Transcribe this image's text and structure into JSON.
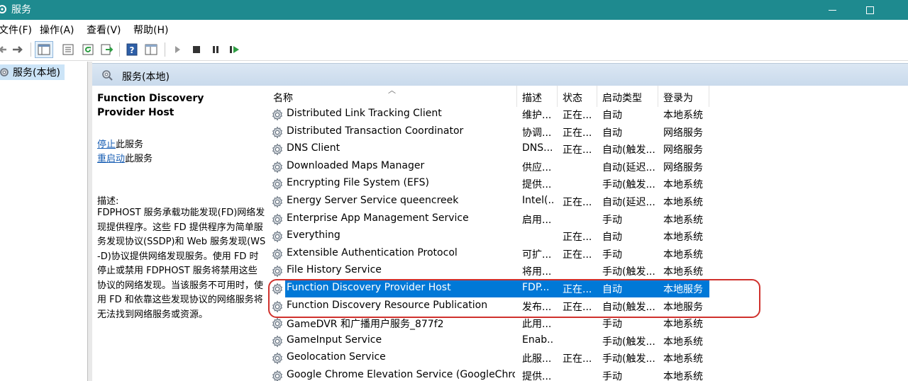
{
  "window": {
    "title": "服务"
  },
  "menu": [
    "文件(F)",
    "操作(A)",
    "查看(V)",
    "帮助(H)"
  ],
  "toolbar": {
    "buttons": [
      "back-icon",
      "forward-icon",
      "show-tree-icon",
      "properties-icon",
      "refresh-icon",
      "export-icon",
      "help-icon",
      "console-icon",
      "start-icon",
      "stop-icon",
      "pause-icon",
      "resume-icon"
    ]
  },
  "tree": {
    "label": "服务(本地)"
  },
  "pane": {
    "header": "服务(本地)"
  },
  "detail": {
    "service_name": "Function Discovery Provider Host",
    "stop_link": "停止",
    "stop_suffix": "此服务",
    "restart_link": "重启动",
    "restart_suffix": "此服务",
    "description_label": "描述:",
    "description": "FDPHOST 服务承载功能发现(FD)网络发现提供程序。这些 FD 提供程序为简单服务发现协议(SSDP)和 Web 服务发现(WS-D)协议提供网络发现服务。使用 FD 时停止或禁用 FDPHOST 服务将禁用这些协议的网络发现。当该服务不可用时，使用 FD 和依靠这些发现协议的网络服务将无法找到网络服务或资源。"
  },
  "columns": {
    "name": "名称",
    "desc": "描述",
    "status": "状态",
    "startup": "启动类型",
    "logon": "登录为"
  },
  "services": [
    {
      "name": "Distributed Link Tracking Client",
      "desc": "维护...",
      "status": "正在...",
      "startup": "自动",
      "logon": "本地系统"
    },
    {
      "name": "Distributed Transaction Coordinator",
      "desc": "协调...",
      "status": "正在...",
      "startup": "自动",
      "logon": "网络服务"
    },
    {
      "name": "DNS Client",
      "desc": "DNS...",
      "status": "正在...",
      "startup": "自动(触发...",
      "logon": "网络服务"
    },
    {
      "name": "Downloaded Maps Manager",
      "desc": "供应...",
      "status": "",
      "startup": "自动(延迟...",
      "logon": "网络服务"
    },
    {
      "name": "Encrypting File System (EFS)",
      "desc": "提供...",
      "status": "",
      "startup": "手动(触发...",
      "logon": "本地系统"
    },
    {
      "name": "Energy Server Service queencreek",
      "desc": "Intel(...",
      "status": "正在...",
      "startup": "自动(延迟...",
      "logon": "本地系统"
    },
    {
      "name": "Enterprise App Management Service",
      "desc": "启用...",
      "status": "",
      "startup": "手动",
      "logon": "本地系统"
    },
    {
      "name": "Everything",
      "desc": "",
      "status": "正在...",
      "startup": "自动",
      "logon": "本地系统"
    },
    {
      "name": "Extensible Authentication Protocol",
      "desc": "可扩...",
      "status": "正在...",
      "startup": "手动",
      "logon": "本地系统"
    },
    {
      "name": "File History Service",
      "desc": "将用...",
      "status": "",
      "startup": "手动(触发...",
      "logon": "本地系统"
    },
    {
      "name": "Function Discovery Provider Host",
      "desc": "FDP...",
      "status": "正在...",
      "startup": "自动",
      "logon": "本地服务",
      "selected": true
    },
    {
      "name": "Function Discovery Resource Publication",
      "desc": "发布...",
      "status": "正在...",
      "startup": "自动(触发...",
      "logon": "本地服务"
    },
    {
      "name": "GameDVR 和广播用户服务_877f2",
      "desc": "此用...",
      "status": "",
      "startup": "手动",
      "logon": "本地系统"
    },
    {
      "name": "GameInput Service",
      "desc": "Enab...",
      "status": "",
      "startup": "手动(触发...",
      "logon": "本地系统"
    },
    {
      "name": "Geolocation Service",
      "desc": "此服...",
      "status": "正在...",
      "startup": "手动(触发...",
      "logon": "本地系统"
    },
    {
      "name": "Google Chrome Elevation Service (GoogleChrom...",
      "desc": "提供...",
      "status": "",
      "startup": "手动",
      "logon": "本地系统"
    }
  ]
}
